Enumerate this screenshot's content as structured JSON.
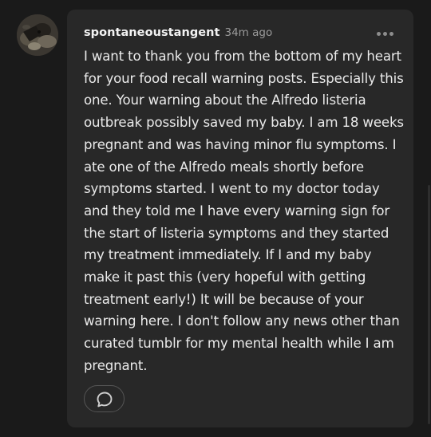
{
  "post": {
    "author": {
      "username": "spontaneoustangent",
      "avatar_icon": "dog-avatar"
    },
    "timestamp": "34m ago",
    "text": "I want to thank you from the bottom of my heart for your food recall warning posts. Especially this one. Your warning about the Alfredo listeria outbreak possibly saved my baby. I am 18 weeks pregnant and was having minor flu symptoms. I ate one of the Alfredo meals shortly before symptoms started. I went to my doctor today and they told me I have every warning sign for the start of listeria symptoms and they started my treatment immediately.  If I and my baby make it past this (very hopeful with getting treatment early!) It will be because of your warning here. I don't follow any news other than curated tumblr for my mental health while I am pregnant.",
    "more_icon": "more-horizontal-icon",
    "reply_icon": "speech-bubble-icon"
  },
  "colors": {
    "page_background": "#1a1a1a",
    "card_background": "#282828",
    "text_primary": "#eaeaea",
    "text_secondary": "#9a9a9a"
  }
}
